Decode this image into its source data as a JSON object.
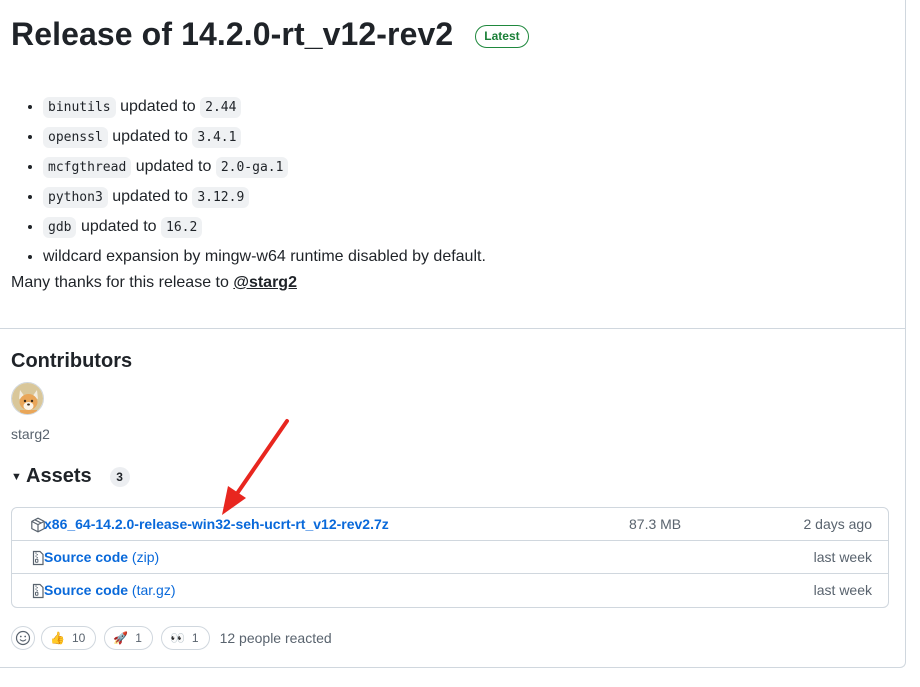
{
  "release": {
    "title": "Release of 14.2.0-rt_v12-rev2",
    "badge": "Latest"
  },
  "notes": [
    {
      "code": "binutils",
      "text": "updated to",
      "version": "2.44"
    },
    {
      "code": "openssl",
      "text": "updated to",
      "version": "3.4.1"
    },
    {
      "code": "mcfgthread",
      "text": "updated to",
      "version": "2.0-ga.1"
    },
    {
      "code": "python3",
      "text": "updated to",
      "version": "3.12.9"
    },
    {
      "code": "gdb",
      "text": "updated to",
      "version": "16.2"
    }
  ],
  "note_plain": "wildcard expansion by mingw-w64 runtime disabled by default.",
  "thanks": {
    "prefix": "Many thanks for this release to",
    "mention": "@starg2"
  },
  "contributors": {
    "heading": "Contributors",
    "name": "starg2"
  },
  "assets": {
    "heading": "Assets",
    "count": "3",
    "items": [
      {
        "name": "x86_64-14.2.0-release-win32-seh-ucrt-rt_v12-rev2.7z",
        "ext": "",
        "size": "87.3 MB",
        "date": "2 days ago",
        "icon": "package-icon"
      },
      {
        "name": "Source code",
        "ext": "(zip)",
        "size": "",
        "date": "last week",
        "icon": "file-zip-icon"
      },
      {
        "name": "Source code",
        "ext": "(tar.gz)",
        "size": "",
        "date": "last week",
        "icon": "file-zip-icon"
      }
    ]
  },
  "reactions": {
    "items": [
      {
        "emoji": "👍",
        "count": "10"
      },
      {
        "emoji": "🚀",
        "count": "1"
      },
      {
        "emoji": "👀",
        "count": "1"
      }
    ],
    "summary": "12 people reacted"
  },
  "colors": {
    "link": "#0969da",
    "latest_badge": "#1a7f37",
    "annotation_arrow": "#e8261f"
  }
}
